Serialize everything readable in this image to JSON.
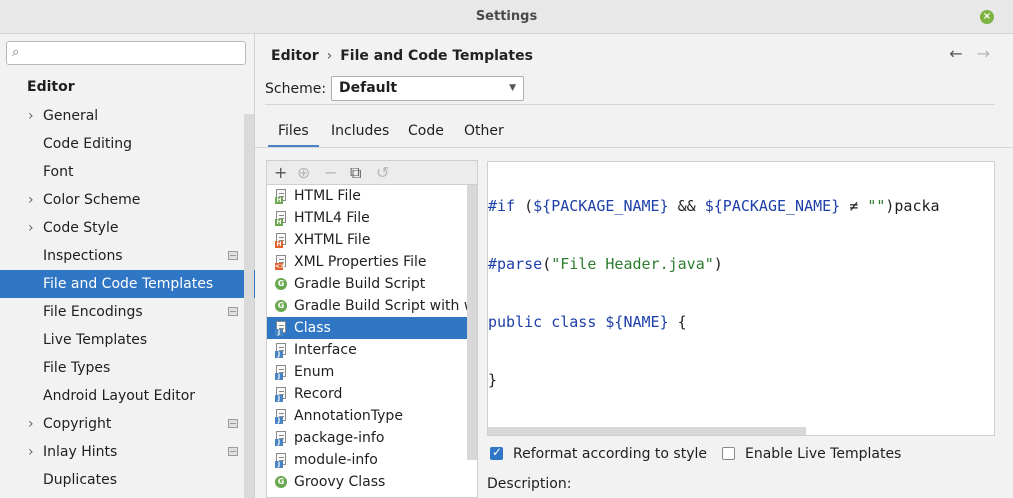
{
  "window": {
    "title": "Settings"
  },
  "sidebar": {
    "search_placeholder": "",
    "header": "Editor",
    "items": [
      {
        "label": "General",
        "expandable": true
      },
      {
        "label": "Code Editing"
      },
      {
        "label": "Font"
      },
      {
        "label": "Color Scheme",
        "expandable": true
      },
      {
        "label": "Code Style",
        "expandable": true
      },
      {
        "label": "Inspections",
        "has_icon": true
      },
      {
        "label": "File and Code Templates",
        "selected": true
      },
      {
        "label": "File Encodings",
        "has_icon": true
      },
      {
        "label": "Live Templates"
      },
      {
        "label": "File Types"
      },
      {
        "label": "Android Layout Editor"
      },
      {
        "label": "Copyright",
        "expandable": true,
        "has_icon": true
      },
      {
        "label": "Inlay Hints",
        "expandable": true,
        "has_icon": true
      },
      {
        "label": "Duplicates"
      }
    ]
  },
  "breadcrumb": {
    "parent": "Editor",
    "separator": "›",
    "current": "File and Code Templates"
  },
  "nav": {
    "back": "←",
    "forward": "→"
  },
  "scheme": {
    "label": "Scheme:",
    "value": "Default"
  },
  "tabs": [
    "Files",
    "Includes",
    "Code",
    "Other"
  ],
  "toolbar": {
    "add": "+",
    "copy_add": "⊕",
    "remove": "−",
    "copy": "⧉",
    "reset": "↺"
  },
  "files": [
    {
      "label": "HTML File",
      "icon": "html-file-icon",
      "badge": "H",
      "badge_color": "#6aa84f"
    },
    {
      "label": "HTML4 File",
      "icon": "html-file-icon",
      "badge": "H",
      "badge_color": "#6aa84f"
    },
    {
      "label": "XHTML File",
      "icon": "xhtml-file-icon",
      "badge": "H",
      "badge_color": "#e0622f"
    },
    {
      "label": "XML Properties File",
      "icon": "xml-file-icon",
      "badge": "<>",
      "badge_color": "#e0622f"
    },
    {
      "label": "Gradle Build Script",
      "icon": "gradle-icon"
    },
    {
      "label": "Gradle Build Script with wrapp",
      "icon": "gradle-icon"
    },
    {
      "label": "Class",
      "icon": "java-file-icon",
      "badge": "J",
      "badge_color": "#4a83c4",
      "selected": true
    },
    {
      "label": "Interface",
      "icon": "java-file-icon",
      "badge": "J",
      "badge_color": "#4a83c4"
    },
    {
      "label": "Enum",
      "icon": "java-file-icon",
      "badge": "J",
      "badge_color": "#4a83c4"
    },
    {
      "label": "Record",
      "icon": "java-file-icon",
      "badge": "J",
      "badge_color": "#4a83c4"
    },
    {
      "label": "AnnotationType",
      "icon": "java-file-icon",
      "badge": "J",
      "badge_color": "#4a83c4"
    },
    {
      "label": "package-info",
      "icon": "java-file-icon",
      "badge": "J",
      "badge_color": "#4a83c4"
    },
    {
      "label": "module-info",
      "icon": "java-file-icon",
      "badge": "J",
      "badge_color": "#4a83c4"
    },
    {
      "label": "Groovy Class",
      "icon": "groovy-icon"
    }
  ],
  "gradle_letter": "G",
  "code": {
    "line1": {
      "a": "#if ",
      "b": "(",
      "c": "${PACKAGE_NAME}",
      "d": " && ",
      "e": "${PACKAGE_NAME}",
      "f": " ≠ ",
      "g": "\"\"",
      "h": ")packa"
    },
    "line2": {
      "a": "#parse",
      "b": "(",
      "c": "\"File Header.java\"",
      "d": ")"
    },
    "line3": {
      "a": "public class ",
      "b": "${NAME}",
      "c": " {"
    },
    "line4": "}"
  },
  "options": {
    "reformat": {
      "label": "Reformat according to style",
      "checked": true
    },
    "live_templates": {
      "label": "Enable Live Templates",
      "checked": false
    }
  },
  "description_label": "Description:",
  "colors": {
    "accent": "#2f76c4",
    "keyword": "#1d3fa8",
    "string": "#2e7d2e"
  }
}
